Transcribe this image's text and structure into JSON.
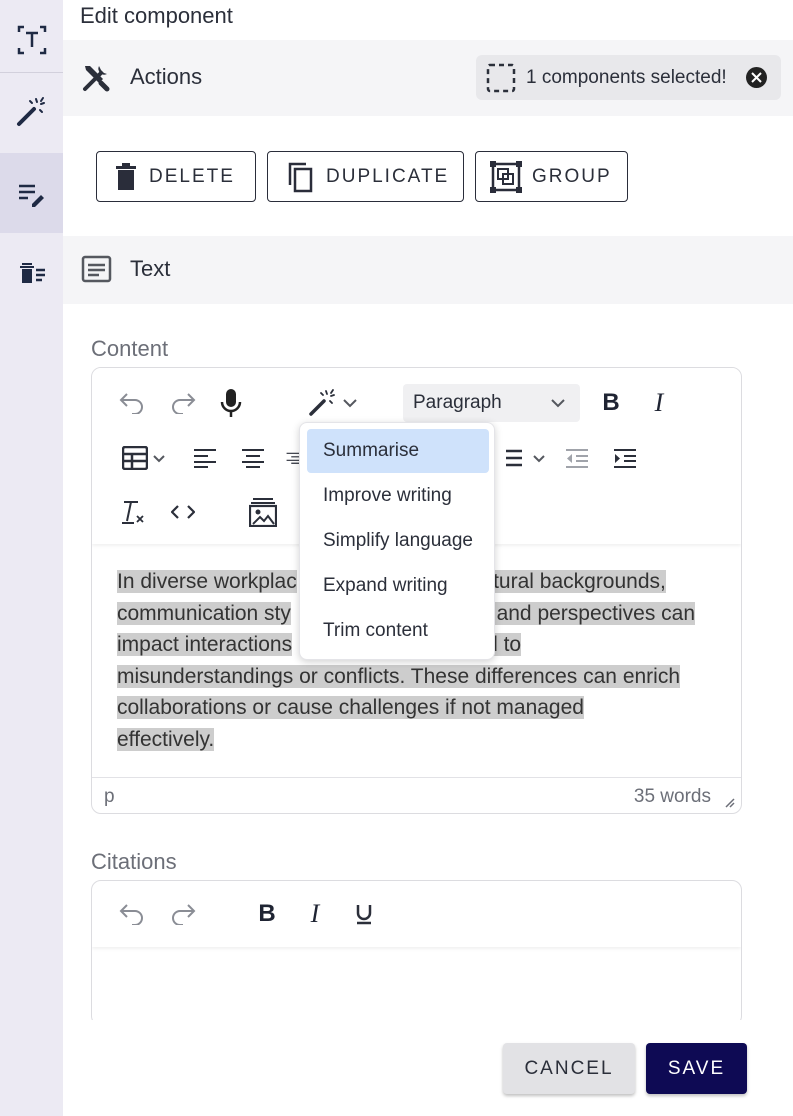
{
  "header": {
    "title": "Edit component"
  },
  "rail": {
    "items": [
      {
        "icon": "text-frame-icon"
      },
      {
        "icon": "magic-wand-icon"
      },
      {
        "icon": "edit-list-icon",
        "active": true
      },
      {
        "icon": "delete-list-icon"
      }
    ]
  },
  "actions": {
    "label": "Actions",
    "selected_text": "1 components selected!",
    "buttons": {
      "delete": "DELETE",
      "duplicate": "DUPLICATE",
      "group": "GROUP"
    }
  },
  "text_section": {
    "label": "Text"
  },
  "content": {
    "label": "Content",
    "block_format": "Paragraph",
    "ai_menu": {
      "items": [
        "Summarise",
        "Improve writing",
        "Simplify language",
        "Expand writing",
        "Trim content"
      ],
      "active_index": 0
    },
    "text": {
      "line1a": "In diverse workplac",
      "line1b": "ultural backgrounds,",
      "line2a": "communication sty",
      "line2b": ", and perspectives can",
      "line3a": "impact interactions",
      "line3b": "d to",
      "line4": "misunderstandings or conflicts. These differences can enrich",
      "line5": "collaborations or cause challenges if not managed",
      "line6": "effectively."
    },
    "status_path": "p",
    "word_count": "35 words"
  },
  "citations": {
    "label": "Citations"
  },
  "footer": {
    "cancel": "CANCEL",
    "save": "SAVE"
  },
  "colors": {
    "primary": "#0e0a54",
    "highlight": "#cfe2fb",
    "rail_bg": "#eceaf3"
  }
}
